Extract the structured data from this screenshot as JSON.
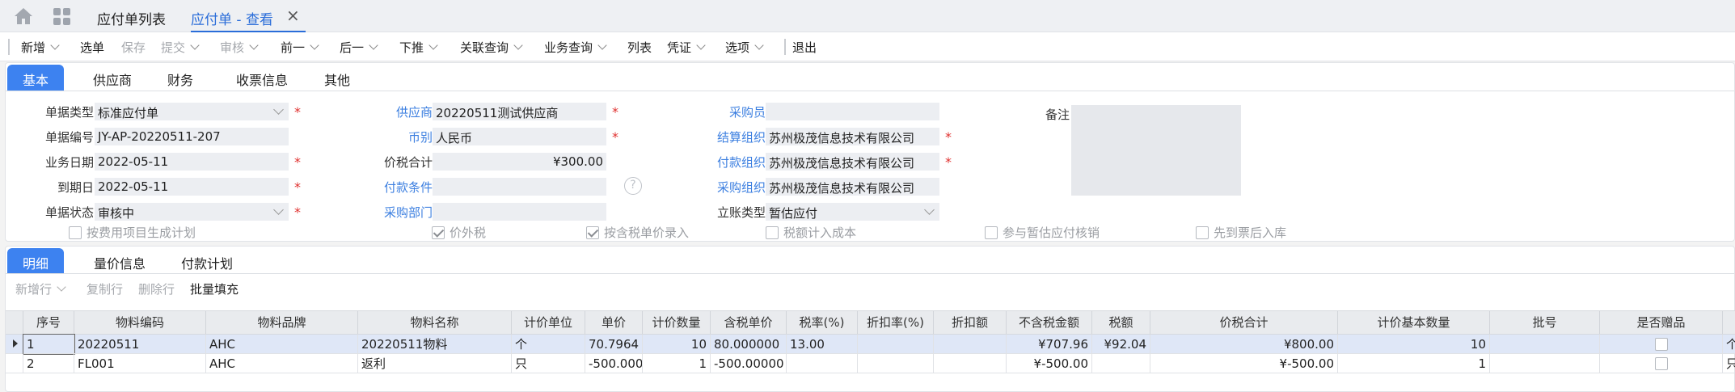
{
  "tabs": {
    "list_tab": "应付单列表",
    "view_tab": "应付单 - 查看",
    "close": "×"
  },
  "toolbar": [
    {
      "label": "新增",
      "caret": true,
      "disabled": false
    },
    {
      "label": "选单",
      "caret": false,
      "disabled": false
    },
    {
      "label": "保存",
      "caret": false,
      "disabled": true
    },
    {
      "label": "提交",
      "caret": true,
      "disabled": true
    },
    {
      "label": "审核",
      "caret": true,
      "disabled": true
    },
    {
      "label": "前一",
      "caret": true,
      "disabled": false
    },
    {
      "label": "后一",
      "caret": true,
      "disabled": false
    },
    {
      "label": "下推",
      "caret": true,
      "disabled": false
    },
    {
      "label": "关联查询",
      "caret": true,
      "disabled": false
    },
    {
      "label": "业务查询",
      "caret": true,
      "disabled": false
    },
    {
      "label": "列表",
      "caret": false,
      "disabled": false
    },
    {
      "label": "凭证",
      "caret": true,
      "disabled": false
    },
    {
      "label": "选项",
      "caret": true,
      "disabled": false
    },
    {
      "label": "退出",
      "caret": false,
      "disabled": false
    }
  ],
  "form_tabs": [
    "基本",
    "供应商",
    "财务",
    "收票信息",
    "其他"
  ],
  "form": {
    "bill_type": {
      "label": "单据类型",
      "value": "标准应付单"
    },
    "bill_no": {
      "label": "单据编号",
      "value": "JY-AP-20220511-207"
    },
    "biz_date": {
      "label": "业务日期",
      "value": "2022-05-11"
    },
    "due_date": {
      "label": "到期日",
      "value": "2022-05-11"
    },
    "bill_status": {
      "label": "单据状态",
      "value": "审核中"
    },
    "supplier": {
      "label": "供应商",
      "value": "20220511测试供应商"
    },
    "currency": {
      "label": "币别",
      "value": "人民币"
    },
    "total": {
      "label": "价税合计",
      "value": "¥300.00"
    },
    "pay_terms": {
      "label": "付款条件",
      "value": ""
    },
    "purchase_dept": {
      "label": "采购部门",
      "value": ""
    },
    "purchaser": {
      "label": "采购员",
      "value": ""
    },
    "settle_org": {
      "label": "结算组织",
      "value": "苏州极茂信息技术有限公司"
    },
    "pay_org": {
      "label": "付款组织",
      "value": "苏州极茂信息技术有限公司"
    },
    "purchase_org": {
      "label": "采购组织",
      "value": "苏州极茂信息技术有限公司"
    },
    "account_type": {
      "label": "立账类型",
      "value": "暂估应付"
    },
    "memo": {
      "label": "备注",
      "value": ""
    },
    "help": "?"
  },
  "checkboxes": [
    {
      "label": "按费用项目生成计划",
      "checked": false
    },
    {
      "label": "价外税",
      "checked": true
    },
    {
      "label": "按含税单价录入",
      "checked": true
    },
    {
      "label": "税额计入成本",
      "checked": false
    },
    {
      "label": "参与暂估应付核销",
      "checked": false
    },
    {
      "label": "先到票后入库",
      "checked": false
    }
  ],
  "detail_tabs": [
    "明细",
    "量价信息",
    "付款计划"
  ],
  "row_tools": [
    {
      "label": "新增行",
      "caret": true,
      "enabled": false
    },
    {
      "label": "复制行",
      "caret": false,
      "enabled": false
    },
    {
      "label": "删除行",
      "caret": false,
      "enabled": false
    },
    {
      "label": "批量填充",
      "caret": false,
      "enabled": true
    }
  ],
  "table": {
    "columns": [
      "",
      "序号",
      "物料编码",
      "物料品牌",
      "物料名称",
      "计价单位",
      "单价",
      "计价数量",
      "含税单价",
      "税率(%)",
      "折扣率(%)",
      "折扣额",
      "不含税金额",
      "税额",
      "价税合计",
      "计价基本数量",
      "批号",
      "是否赠品",
      ""
    ],
    "rows": [
      [
        "",
        "1",
        "20220511",
        "AHC",
        "20220511物料",
        "个",
        "70.7964",
        "10",
        "80.000000",
        "13.00",
        "",
        "",
        "¥707.96",
        "¥92.04",
        "¥800.00",
        "10",
        "",
        "",
        "个"
      ],
      [
        "",
        "2",
        "FL001",
        "AHC",
        "返利",
        "只",
        "-500.000",
        "1",
        "-500.00000",
        "",
        "",
        "",
        "¥-500.00",
        "",
        "¥-500.00",
        "1",
        "",
        "",
        "只"
      ]
    ]
  },
  "colors": {
    "accent": "#3d82f0",
    "link": "#3c7fe0",
    "required": "#e0312f",
    "selected_row": "#dfe7f7"
  }
}
